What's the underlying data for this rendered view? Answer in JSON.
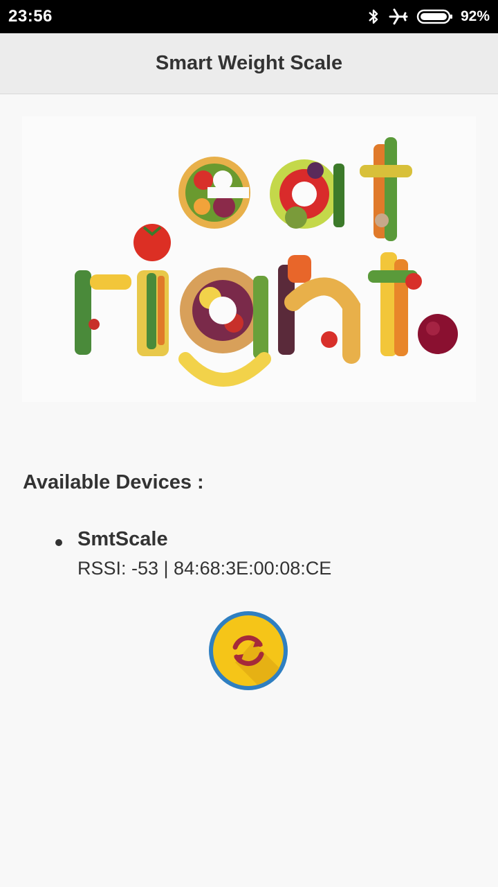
{
  "status_bar": {
    "time": "23:56",
    "battery": "92%",
    "icons": [
      "bluetooth-icon",
      "airplane-mode-icon",
      "battery-icon"
    ]
  },
  "app_bar": {
    "title": "Smart Weight Scale"
  },
  "hero": {
    "icon": "healthy-food-banner-image"
  },
  "devices": {
    "heading": "Available Devices :",
    "items": [
      {
        "name": "SmtScale",
        "info": "RSSI: -53 | 84:68:3E:00:08:CE"
      }
    ]
  },
  "refresh": {
    "icon": "refresh-icon"
  },
  "colors": {
    "status_bar": "#000000",
    "app_bar": "#ececec",
    "background": "#f8f8f8",
    "text": "#333333",
    "refresh_fill": "#f5c518",
    "refresh_ring": "#2f7fc1",
    "refresh_arrows": "#a52a3a"
  }
}
